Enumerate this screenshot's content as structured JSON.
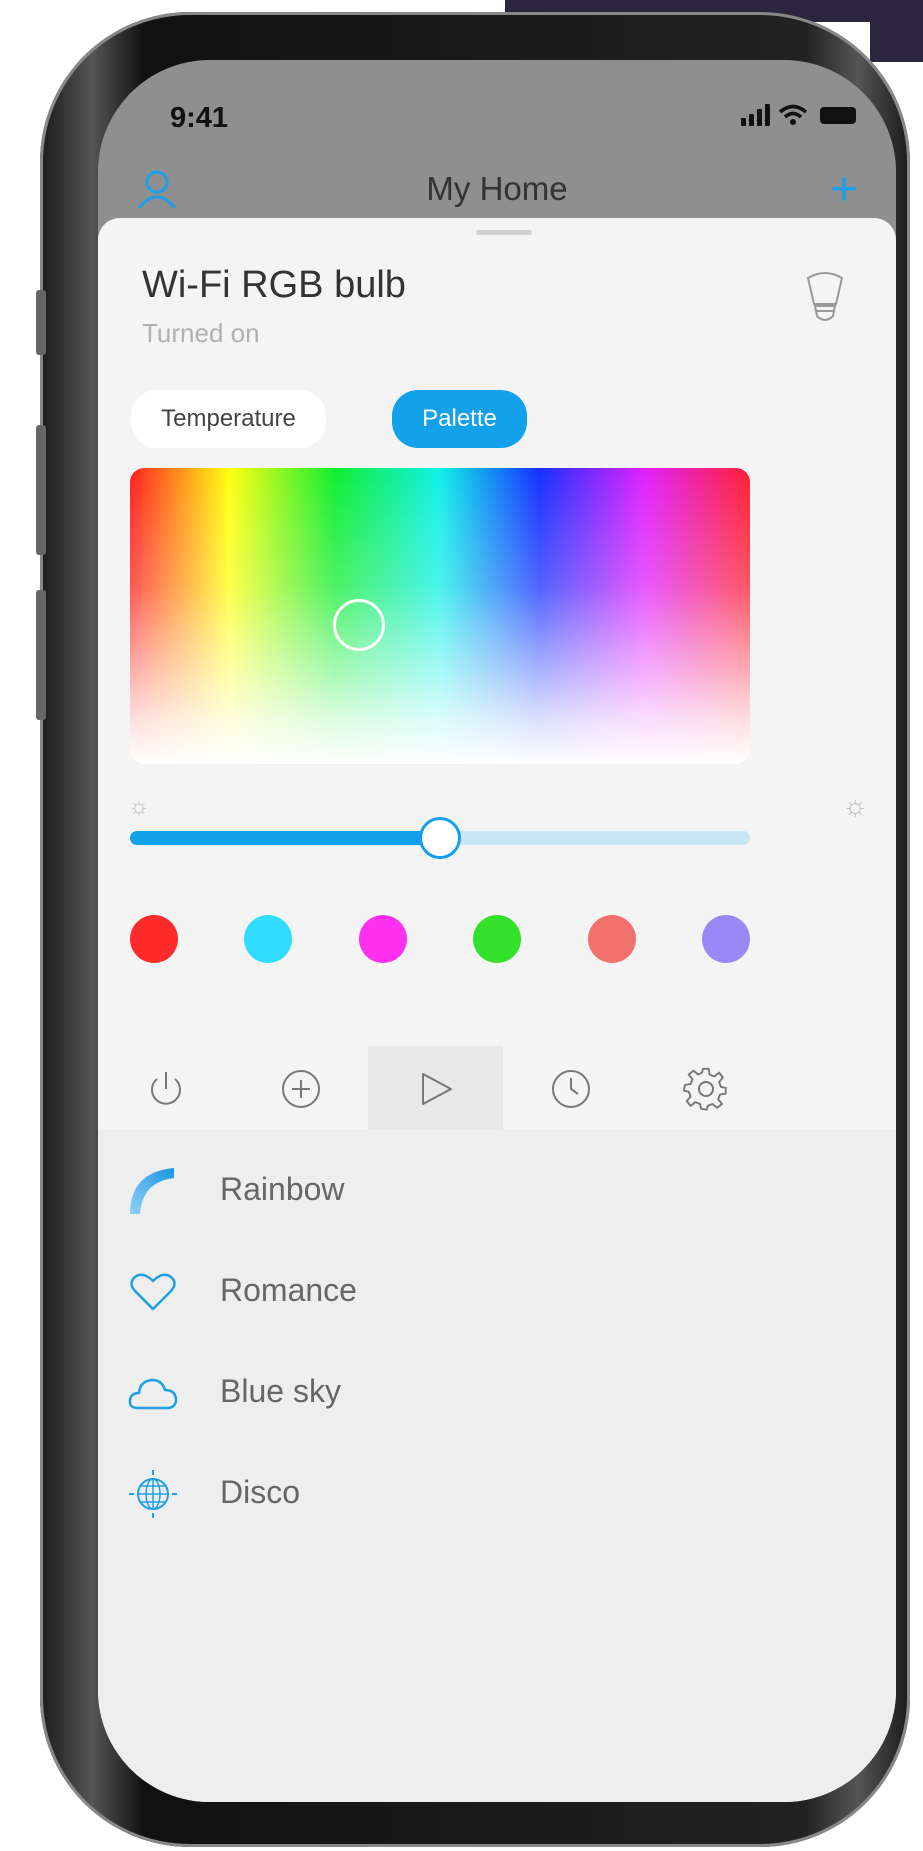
{
  "status_bar": {
    "time": "9:41"
  },
  "nav": {
    "title": "My Home"
  },
  "device": {
    "name": "Wi-Fi RGB bulb",
    "status": "Turned on"
  },
  "mode_tabs": [
    {
      "label": "Temperature",
      "selected": false
    },
    {
      "label": "Palette",
      "selected": true
    }
  ],
  "brightness": {
    "value": 0.5
  },
  "swatches": [
    "#ff2a2a",
    "#30dcff",
    "#ff30f0",
    "#33e02a",
    "#f2716d",
    "#9a88f7"
  ],
  "bottom_tabs": [
    {
      "icon": "power-icon",
      "active": false
    },
    {
      "icon": "add-circle-icon",
      "active": false
    },
    {
      "icon": "play-icon",
      "active": true
    },
    {
      "icon": "clock-icon",
      "active": false
    },
    {
      "icon": "gear-icon",
      "active": false
    }
  ],
  "scenes": [
    {
      "label": "Rainbow",
      "icon": "rainbow-icon"
    },
    {
      "label": "Romance",
      "icon": "heart-icon"
    },
    {
      "label": "Blue sky",
      "icon": "cloud-icon"
    },
    {
      "label": "Disco",
      "icon": "disco-ball-icon"
    }
  ],
  "colors": {
    "accent": "#12a1ea",
    "track": "#c9e6f6"
  }
}
